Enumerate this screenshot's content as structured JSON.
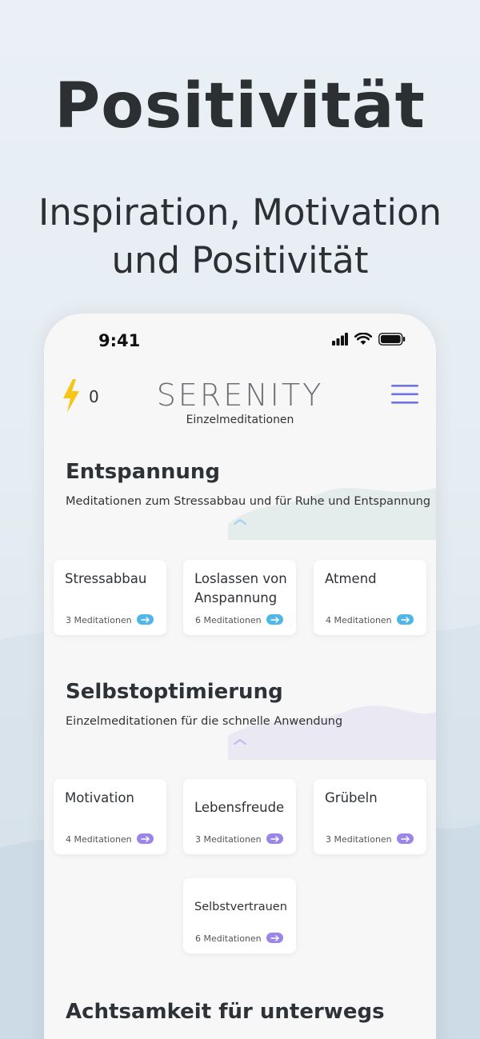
{
  "promo": {
    "title": "Positivität",
    "subtitle_line1": "Inspiration, Motivation",
    "subtitle_line2": "und Positivität"
  },
  "status_bar": {
    "time": "9:41",
    "icons": [
      "cellular-signal-icon",
      "wifi-icon",
      "battery-icon"
    ]
  },
  "header": {
    "streak_icon": "lightning-bolt-icon",
    "streak_count": "0",
    "brand": "SERENITY",
    "subtitle": "Einzelmeditationen",
    "menu_icon": "hamburger-menu-icon"
  },
  "colors": {
    "arrow_blue": "#4fb6e6",
    "arrow_purple": "#9b86e8",
    "menu_accent": "#6f74e0",
    "bolt": "#f5c518"
  },
  "sections": [
    {
      "title": "Entspannung",
      "description": "Meditationen zum Stressabbau und für Ruhe und Entspannung",
      "cards": [
        {
          "title": "Stressabbau",
          "count": "3 Meditationen"
        },
        {
          "title": "Loslassen von Anspannung",
          "count": "6 Meditationen"
        },
        {
          "title": "Atmend",
          "count": "4 Meditationen"
        }
      ]
    },
    {
      "title": "Selbstoptimierung",
      "description": "Einzelmeditationen für die schnelle Anwendung",
      "cards": [
        {
          "title": "Motivation",
          "count": "4 Meditationen"
        },
        {
          "title": "Lebensfreude",
          "count": "3 Meditationen"
        },
        {
          "title": "Grübeln",
          "count": "3 Meditationen"
        },
        {
          "title": "Selbstvertrauen",
          "count": "6 Meditationen"
        }
      ]
    },
    {
      "title": "Achtsamkeit für unterwegs"
    }
  ]
}
